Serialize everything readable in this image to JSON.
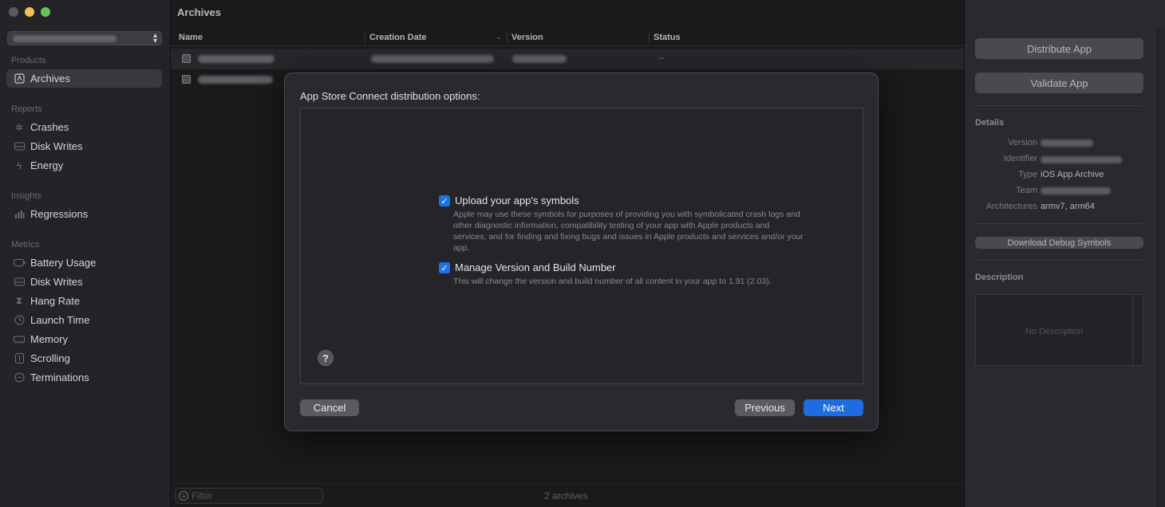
{
  "window": {
    "title": "Archives"
  },
  "sidebar": {
    "sections": [
      {
        "title": "Products",
        "items": [
          {
            "label": "Archives",
            "icon": "archive-icon",
            "selected": true
          }
        ]
      },
      {
        "title": "Reports",
        "items": [
          {
            "label": "Crashes",
            "icon": "crash-icon"
          },
          {
            "label": "Disk Writes",
            "icon": "disk-icon"
          },
          {
            "label": "Energy",
            "icon": "bolt-icon"
          }
        ]
      },
      {
        "title": "Insights",
        "items": [
          {
            "label": "Regressions",
            "icon": "bars-icon"
          }
        ]
      },
      {
        "title": "Metrics",
        "items": [
          {
            "label": "Battery Usage",
            "icon": "battery-icon"
          },
          {
            "label": "Disk Writes",
            "icon": "disk-icon"
          },
          {
            "label": "Hang Rate",
            "icon": "hourglass-icon"
          },
          {
            "label": "Launch Time",
            "icon": "clock-icon"
          },
          {
            "label": "Memory",
            "icon": "memory-icon"
          },
          {
            "label": "Scrolling",
            "icon": "scroll-icon"
          },
          {
            "label": "Terminations",
            "icon": "terminate-icon"
          }
        ]
      }
    ]
  },
  "table": {
    "columns": [
      "Name",
      "Creation Date",
      "Version",
      "Status"
    ],
    "rows": [
      {
        "status": "--"
      },
      {
        "status": ""
      }
    ]
  },
  "footer": {
    "filter_placeholder": "Filter",
    "count": "2 archives"
  },
  "inspector": {
    "distribute_label": "Distribute App",
    "validate_label": "Validate App",
    "details_title": "Details",
    "details": {
      "version_key": "Version",
      "identifier_key": "Identifier",
      "type_key": "Type",
      "type_value": "iOS App Archive",
      "team_key": "Team",
      "arch_key": "Architectures",
      "arch_value": "armv7, arm64"
    },
    "debug_symbols_label": "Download Debug Symbols",
    "description_title": "Description",
    "description_placeholder": "No Description"
  },
  "modal": {
    "title": "App Store Connect distribution options:",
    "options": [
      {
        "label": "Upload your app's symbols",
        "checked": true,
        "description": "Apple may use these symbols for purposes of providing you with symbolicated crash logs and other diagnostic information, compatibility testing of your app with Apple products and services, and for finding and fixing bugs and issues in Apple products and services and/or your app."
      },
      {
        "label": "Manage Version and Build Number",
        "checked": true,
        "description": "This will change the version and build number of all content in your app to 1.91 (2.03)."
      }
    ],
    "help_label": "?",
    "cancel_label": "Cancel",
    "previous_label": "Previous",
    "next_label": "Next"
  },
  "colors": {
    "accent": "#1d6ce0",
    "window_bg": "#1e1e1e",
    "sidebar_bg": "#242328"
  }
}
